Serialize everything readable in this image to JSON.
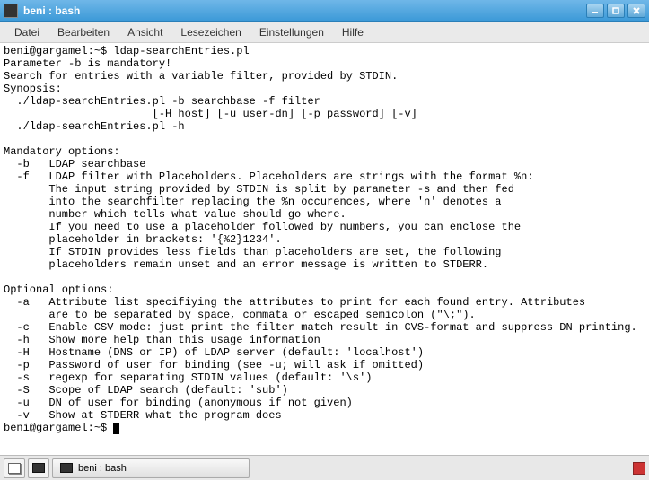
{
  "window": {
    "title": "beni : bash"
  },
  "menubar": {
    "items": [
      "Datei",
      "Bearbeiten",
      "Ansicht",
      "Lesezeichen",
      "Einstellungen",
      "Hilfe"
    ]
  },
  "terminal": {
    "prompt1": "beni@gargamel:~$ ",
    "command1": "ldap-searchEntries.pl",
    "lines": [
      "Parameter -b is mandatory!",
      "Search for entries with a variable filter, provided by STDIN.",
      "Synopsis:",
      "  ./ldap-searchEntries.pl -b searchbase -f filter",
      "                       [-H host] [-u user-dn] [-p password] [-v]",
      "  ./ldap-searchEntries.pl -h",
      "",
      "Mandatory options:",
      "  -b   LDAP searchbase",
      "  -f   LDAP filter with Placeholders. Placeholders are strings with the format %n:",
      "       The input string provided by STDIN is split by parameter -s and then fed",
      "       into the searchfilter replacing the %n occurences, where 'n' denotes a",
      "       number which tells what value should go where.",
      "       If you need to use a placeholder followed by numbers, you can enclose the",
      "       placeholder in brackets: '{%2}1234'.",
      "       If STDIN provides less fields than placeholders are set, the following",
      "       placeholders remain unset and an error message is written to STDERR.",
      "",
      "Optional options:",
      "  -a   Attribute list specifiying the attributes to print for each found entry. Attributes",
      "       are to be separated by space, commata or escaped semicolon (\"\\;\").",
      "  -c   Enable CSV mode: just print the filter match result in CVS-format and suppress DN printing.",
      "  -h   Show more help than this usage information",
      "  -H   Hostname (DNS or IP) of LDAP server (default: 'localhost')",
      "  -p   Password of user for binding (see -u; will ask if omitted)",
      "  -s   regexp for separating STDIN values (default: '\\s')",
      "  -S   Scope of LDAP search (default: 'sub')",
      "  -u   DN of user for binding (anonymous if not given)",
      "  -v   Show at STDERR what the program does"
    ],
    "prompt2": "beni@gargamel:~$ "
  },
  "taskbar": {
    "active_task": "beni : bash"
  }
}
